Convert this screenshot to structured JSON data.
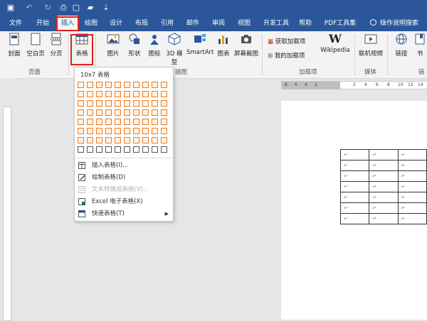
{
  "qat": {
    "save_icon": "save-icon",
    "undo_icon": "undo-icon",
    "redo_icon": "redo-icon"
  },
  "tabs": [
    {
      "label": "文件"
    },
    {
      "label": "开始"
    },
    {
      "label": "插入"
    },
    {
      "label": "绘图"
    },
    {
      "label": "设计"
    },
    {
      "label": "布局"
    },
    {
      "label": "引用"
    },
    {
      "label": "邮件"
    },
    {
      "label": "审阅"
    },
    {
      "label": "视图"
    },
    {
      "label": "开发工具"
    },
    {
      "label": "帮助"
    },
    {
      "label": "PDF工具集"
    }
  ],
  "search": {
    "label": "操作说明搜索"
  },
  "ribbon": {
    "pages_group": {
      "label": "页面",
      "cover": "封面",
      "blank": "空白页",
      "break": "分页"
    },
    "table_button": "表格",
    "illus_group": {
      "label": "插图",
      "picture": "图片",
      "shapes": "形状",
      "icons": "图标",
      "models": "3D 模型",
      "smartart": "SmartArt",
      "chart": "图表",
      "screenshot": "屏幕截图"
    },
    "addins_group": {
      "label": "加载项",
      "get": "获取加载项",
      "my": "我的加载项",
      "wiki": "Wikipedia"
    },
    "media_group": {
      "label": "媒体",
      "video": "联机视频"
    },
    "links_group": {
      "label": "链",
      "link": "链接",
      "bookmark": "书"
    }
  },
  "dropdown": {
    "title": "10x7 表格",
    "grid": {
      "cols": 10,
      "rows": 8,
      "sel_cols": 10,
      "sel_rows": 7
    },
    "items": [
      {
        "label": "插入表格(I)...",
        "enabled": true
      },
      {
        "label": "绘制表格(D)",
        "enabled": true
      },
      {
        "label": "文本转换成表格(V)...",
        "enabled": false
      },
      {
        "label": "Excel 电子表格(X)",
        "enabled": true
      },
      {
        "label": "快速表格(T)",
        "enabled": true
      }
    ]
  },
  "ruler": {
    "numbers": [
      "8",
      "6",
      "4",
      "2",
      "",
      "2",
      "4",
      "6",
      "8",
      "10",
      "12",
      "14"
    ]
  },
  "doc_table": {
    "rows": 7,
    "cols": 3,
    "cell_mark": "↵"
  },
  "colors": {
    "accent": "#2b579a",
    "highlight": "#e02020",
    "grid_select": "#f07a1a"
  }
}
